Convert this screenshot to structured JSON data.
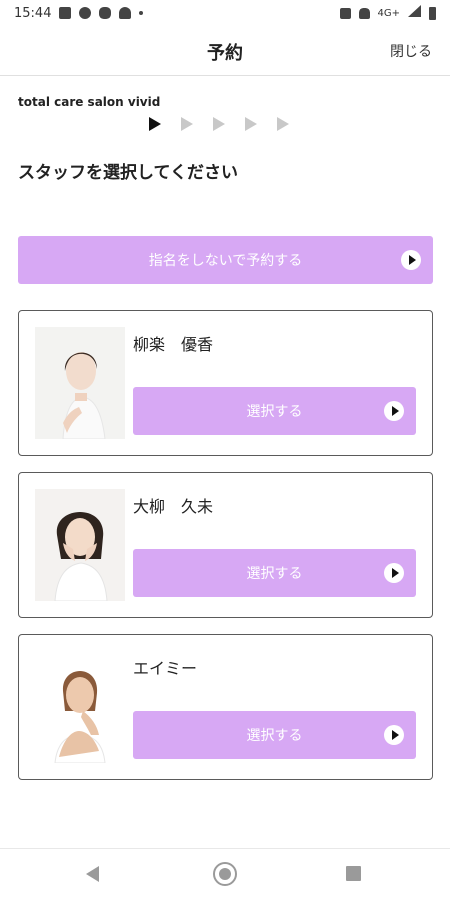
{
  "status_bar": {
    "time": "15:44",
    "network": "4G+",
    "icons": [
      "photo-icon",
      "messenger-icon",
      "line-icon",
      "person-icon",
      "dot-icon",
      "mute-icon",
      "bell-off-icon",
      "signal-icon",
      "battery-icon"
    ]
  },
  "header": {
    "title": "予約",
    "close_label": "閉じる"
  },
  "salon_name": "total care salon vivid",
  "steps": {
    "total": 5,
    "current": 1
  },
  "instruction": "スタッフを選択してください",
  "no_nomination_button": {
    "label": "指名をしないで予約する"
  },
  "staff": [
    {
      "name": "柳楽　優香",
      "select_label": "選択する"
    },
    {
      "name": "大柳　久未",
      "select_label": "選択する"
    },
    {
      "name": "エイミー",
      "select_label": "選択する"
    }
  ],
  "colors": {
    "accent": "#d7a8f4",
    "button_text": "#ffffff",
    "card_border": "#5a5a5a"
  },
  "nav_bar": {
    "icons": [
      "back-icon",
      "home-icon",
      "recents-icon"
    ]
  }
}
